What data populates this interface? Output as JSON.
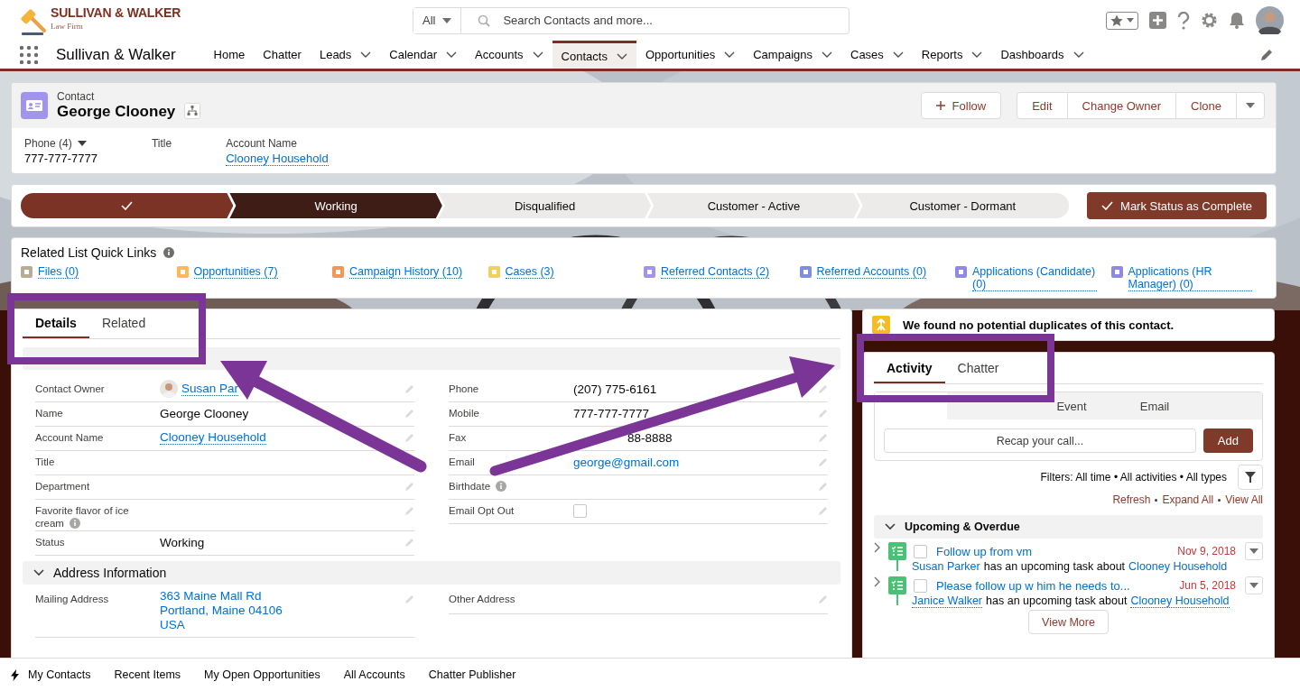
{
  "brand": {
    "org_name": "SULLIVAN & WALKER",
    "tagline": "Law Firm",
    "app_name": "Sullivan & Walker"
  },
  "search": {
    "scope": "All",
    "placeholder": "Search Contacts and more..."
  },
  "nav": [
    {
      "label": "Home",
      "dropdown": false,
      "selected": false
    },
    {
      "label": "Chatter",
      "dropdown": false,
      "selected": false
    },
    {
      "label": "Leads",
      "dropdown": true,
      "selected": false
    },
    {
      "label": "Calendar",
      "dropdown": true,
      "selected": false
    },
    {
      "label": "Accounts",
      "dropdown": true,
      "selected": false
    },
    {
      "label": "Contacts",
      "dropdown": true,
      "selected": true
    },
    {
      "label": "Opportunities",
      "dropdown": true,
      "selected": false
    },
    {
      "label": "Campaigns",
      "dropdown": true,
      "selected": false
    },
    {
      "label": "Cases",
      "dropdown": true,
      "selected": false
    },
    {
      "label": "Reports",
      "dropdown": true,
      "selected": false
    },
    {
      "label": "Dashboards",
      "dropdown": true,
      "selected": false
    }
  ],
  "record": {
    "object_type": "Contact",
    "name": "George Clooney",
    "follow_button": "Follow",
    "buttons": [
      "Edit",
      "Change Owner",
      "Clone"
    ],
    "highlights": [
      {
        "label": "Phone (4)",
        "value": "777-777-7777",
        "kind": "menu"
      },
      {
        "label": "Title",
        "kind": "text"
      },
      {
        "label": "Account Name",
        "value": "Clooney Household",
        "kind": "link"
      }
    ]
  },
  "path": {
    "stages": [
      {
        "completed": true,
        "current": false
      },
      {
        "label": "Working",
        "completed": false,
        "current": true
      },
      {
        "label": "Disqualified",
        "completed": false,
        "current": false
      },
      {
        "label": "Customer - Active",
        "completed": false,
        "current": false
      },
      {
        "label": "Customer - Dormant",
        "completed": false,
        "current": false
      }
    ],
    "mark_button": "Mark Status as Complete"
  },
  "quick_links": {
    "title": "Related List Quick Links",
    "items": [
      {
        "label": "Files (0)",
        "color": "#baac93"
      },
      {
        "label": "Opportunities (7)",
        "color": "#fcb95b"
      },
      {
        "label": "Campaign History (10)",
        "color": "#f49756"
      },
      {
        "label": "Cases (3)",
        "color": "#f2cf5b"
      },
      {
        "label": "Referred Contacts (2)",
        "color": "#a094ed"
      },
      {
        "label": "Referred Accounts (0)",
        "color": "#7f8de1"
      },
      {
        "label": "Applications (Candidate) (0)",
        "color": "#8f88e4"
      },
      {
        "label": "Applications (HR Manager) (0)",
        "color": "#8f88e4"
      }
    ]
  },
  "detail_tabs": [
    {
      "label": "Details",
      "selected": true
    },
    {
      "label": "Related",
      "selected": false
    }
  ],
  "fields_left": [
    {
      "label": "Contact Owner",
      "value": "Susan Par",
      "kind": "owner"
    },
    {
      "label": "Name",
      "value": "George Clooney",
      "kind": "text"
    },
    {
      "label": "Account Name",
      "value": "Clooney Household",
      "kind": "link"
    },
    {
      "label": "Title",
      "kind": "text"
    },
    {
      "label": "Department",
      "kind": "text"
    },
    {
      "label": "Favorite flavor of ice cream",
      "kind": "text",
      "info": true
    },
    {
      "label": "Status",
      "value": "Working",
      "kind": "text"
    }
  ],
  "fields_right": [
    {
      "label": "Phone",
      "value": "(207) 775-6161",
      "kind": "text"
    },
    {
      "label": "Mobile",
      "value": "777-777-7777",
      "kind": "text"
    },
    {
      "label": "Fax",
      "value": "88-8888",
      "kind": "text"
    },
    {
      "label": "Email",
      "value": "george@gmail.com",
      "kind": "link"
    },
    {
      "label": "Birthdate",
      "kind": "text",
      "info": true
    },
    {
      "label": "Email Opt Out",
      "kind": "checkbox",
      "checked": false
    }
  ],
  "address_section": {
    "title": "Address Information",
    "expanded": true,
    "fields": [
      {
        "label": "Mailing Address",
        "lines": [
          "363 Maine Mall Rd",
          "Portland, Maine 04106",
          "USA"
        ]
      },
      {
        "label": "Other Address"
      }
    ]
  },
  "duplicates_notice": "We found no potential duplicates of this contact.",
  "activity": {
    "tabs": [
      {
        "label": "Activity",
        "selected": true
      },
      {
        "label": "Chatter",
        "selected": false
      }
    ],
    "composer_tabs": [
      {
        "label": "Event"
      },
      {
        "label": "Email"
      }
    ],
    "placeholder": "Recap your call...",
    "add_button": "Add",
    "filters": "Filters: All time • All activities • All types",
    "links": [
      "Refresh",
      "Expand All",
      "View All"
    ],
    "section": {
      "title": "Upcoming & Overdue",
      "expanded": true
    },
    "tasks": [
      {
        "subject": "Follow up from vm",
        "date": "Nov 9, 2018",
        "owner": "Susan Parker",
        "text": "has an upcoming task about",
        "about": "Clooney Household",
        "checked": false
      },
      {
        "subject": "Please follow up w him he needs to...",
        "date": "Jun 5, 2018",
        "owner": "Janice Walker",
        "text": "has an upcoming task about",
        "about": "Clooney Household",
        "checked": false
      }
    ],
    "view_more": "View More"
  },
  "utility_bar": [
    {
      "label": "My Contacts",
      "kind": "icon"
    },
    {
      "label": "Recent Items",
      "kind": "plain"
    },
    {
      "label": "My Open Opportunities",
      "kind": "plain"
    },
    {
      "label": "All Accounts",
      "kind": "plain"
    },
    {
      "label": "Chatter Publisher",
      "kind": "plain"
    }
  ]
}
